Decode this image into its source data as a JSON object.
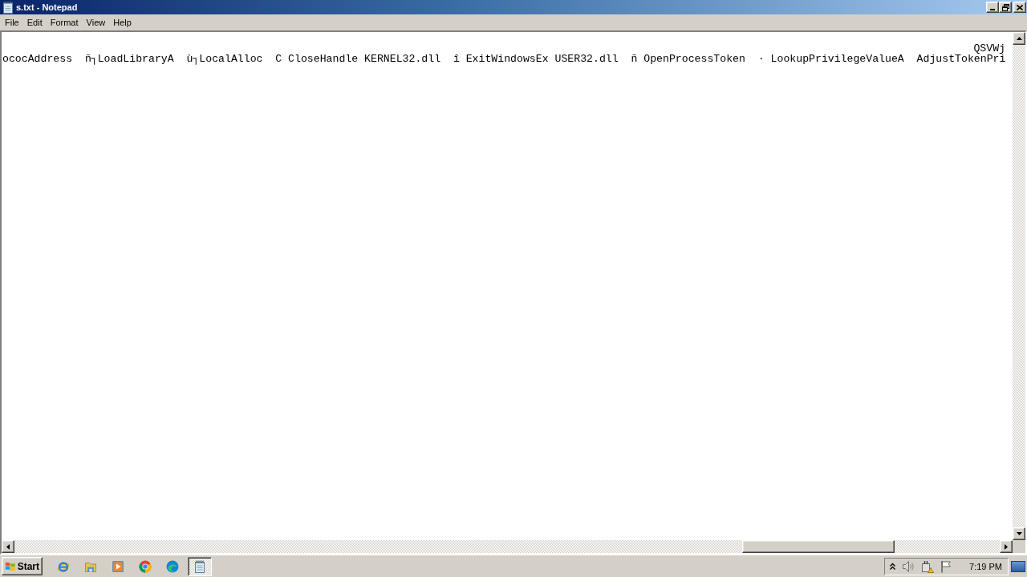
{
  "window": {
    "title": "s.txt - Notepad"
  },
  "menu_bar": [
    "File",
    "Edit",
    "Format",
    "View",
    "Help"
  ],
  "editor": {
    "lines": [
      {
        "kind": "tail",
        "text": "QSVWj"
      },
      {
        "kind": "full",
        "text": "ococAddress  ñ┐LoadLibraryA  ù┐LocalAlloc  C CloseHandle KERNEL32.dll  î ExitWindowsEx USER32.dll  ñ OpenProcessToken  · LookupPrivilegeValueA  AdjustTokenPri"
      }
    ]
  },
  "taskbar": {
    "start_button": "Start",
    "tasks": [
      {
        "kind": "notepad",
        "selected": true
      }
    ],
    "clock": "7:19 PM"
  }
}
